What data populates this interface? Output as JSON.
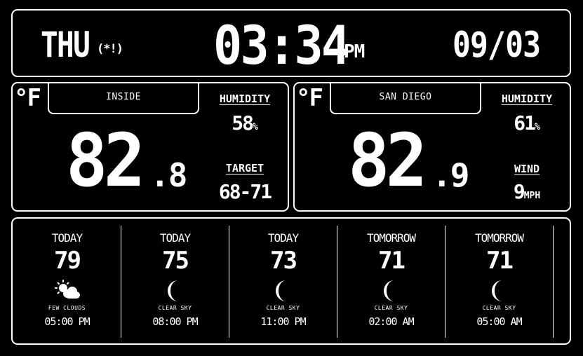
{
  "clock": {
    "day": "THU",
    "day_indicator": "(*!)",
    "time": "03:34",
    "ampm": "PM",
    "date": "09/03"
  },
  "inside": {
    "unit": "°F",
    "location": "INSIDE",
    "temp_whole": "82",
    "temp_decimal": ".8",
    "humidity_label": "HUMIDITY",
    "humidity_value": "58",
    "humidity_unit": "%",
    "target_label": "TARGET",
    "target_value": "68-71"
  },
  "outside": {
    "unit": "°F",
    "location": "SAN DIEGO",
    "temp_whole": "82",
    "temp_decimal": ".9",
    "humidity_label": "HUMIDITY",
    "humidity_value": "61",
    "humidity_unit": "%",
    "wind_label": "WIND",
    "wind_value": "9",
    "wind_unit": "MPH"
  },
  "forecast": [
    {
      "day": "TODAY",
      "temp": "79",
      "icon": "few-clouds-icon",
      "condition": "FEW CLOUDS",
      "time": "05:00 PM"
    },
    {
      "day": "TODAY",
      "temp": "75",
      "icon": "moon-icon",
      "condition": "CLEAR SKY",
      "time": "08:00 PM"
    },
    {
      "day": "TODAY",
      "temp": "73",
      "icon": "moon-icon",
      "condition": "CLEAR SKY",
      "time": "11:00 PM"
    },
    {
      "day": "TOMORROW",
      "temp": "71",
      "icon": "moon-icon",
      "condition": "CLEAR SKY",
      "time": "02:00 AM"
    },
    {
      "day": "TOMORROW",
      "temp": "71",
      "icon": "moon-icon",
      "condition": "CLEAR SKY",
      "time": "05:00 AM"
    }
  ],
  "colors": {
    "background": "#000000",
    "foreground": "#ffffff"
  }
}
